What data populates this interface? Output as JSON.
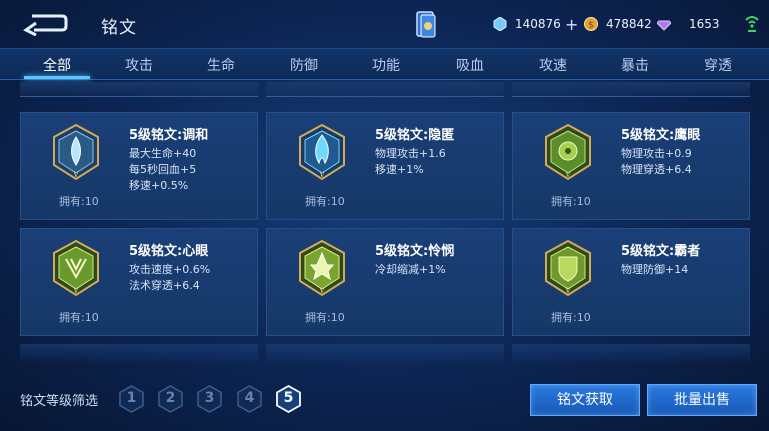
{
  "header": {
    "title": "铭文",
    "diamond": "140876",
    "gold": "478842",
    "gems": "1653"
  },
  "tabs": [
    {
      "label": "全部",
      "active": true
    },
    {
      "label": "攻击"
    },
    {
      "label": "生命"
    },
    {
      "label": "防御"
    },
    {
      "label": "功能"
    },
    {
      "label": "吸血"
    },
    {
      "label": "攻速"
    },
    {
      "label": "暴击"
    },
    {
      "label": "穿透"
    }
  ],
  "runes": [
    {
      "name": "5级铭文:调和",
      "stats": [
        "最大生命+40",
        "每5秒回血+5",
        "移速+0.5%"
      ],
      "owned": "拥有:10",
      "color": "#5aa0c8"
    },
    {
      "name": "5级铭文:隐匿",
      "stats": [
        "物理攻击+1.6",
        "移速+1%"
      ],
      "owned": "拥有:10",
      "color": "#4ab8e0"
    },
    {
      "name": "5级铭文:鹰眼",
      "stats": [
        "物理攻击+0.9",
        "物理穿透+6.4"
      ],
      "owned": "拥有:10",
      "color": "#7ab83a"
    },
    {
      "name": "5级铭文:心眼",
      "stats": [
        "攻击速度+0.6%",
        "法术穿透+6.4"
      ],
      "owned": "拥有:10",
      "color": "#7ab83a"
    },
    {
      "name": "5级铭文:怜悯",
      "stats": [
        "冷却缩减+1%"
      ],
      "owned": "拥有:10",
      "color": "#9ac040"
    },
    {
      "name": "5级铭文:霸者",
      "stats": [
        "物理防御+14"
      ],
      "owned": "拥有:10",
      "color": "#8ab83a"
    }
  ],
  "filter": {
    "label": "铭文等级筛选",
    "levels": [
      "1",
      "2",
      "3",
      "4",
      "5"
    ],
    "selected": "5"
  },
  "buttons": {
    "get": "铭文获取",
    "sell": "批量出售"
  },
  "colors": {
    "accent": "#5cc8ff",
    "button": "#2a7ae0",
    "frame_gold": "#d4aa5a"
  }
}
